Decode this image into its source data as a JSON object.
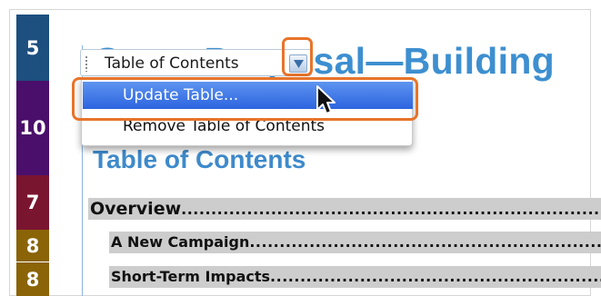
{
  "document": {
    "title": "Grant Proposal—Building",
    "toc_heading": "Table of Contents"
  },
  "levels": [
    {
      "label": "5",
      "color": "#1d4f7f"
    },
    {
      "label": "10",
      "color": "#4a0f6b"
    },
    {
      "label": "7",
      "color": "#7a1530"
    },
    {
      "label": "8",
      "color": "#8a6407"
    },
    {
      "label": "8",
      "color": "#8a6407"
    }
  ],
  "toc_entries": [
    {
      "text": "Overview",
      "leader": "......................................................................"
    },
    {
      "text": "A New Campaign",
      "leader": "..................................................................."
    },
    {
      "text": "Short-Term Impacts",
      "leader": "..................................................................."
    }
  ],
  "toc_control": {
    "label": "Table of Contents",
    "dropdown_icon": "triangle-down-icon"
  },
  "menu": {
    "items": [
      {
        "label": "Update Table...",
        "selected": true
      },
      {
        "label": "Remove Table of Contents",
        "selected": false
      }
    ]
  },
  "callout_color": "#e8742a",
  "cursor_icon": "arrow-pointer-icon"
}
